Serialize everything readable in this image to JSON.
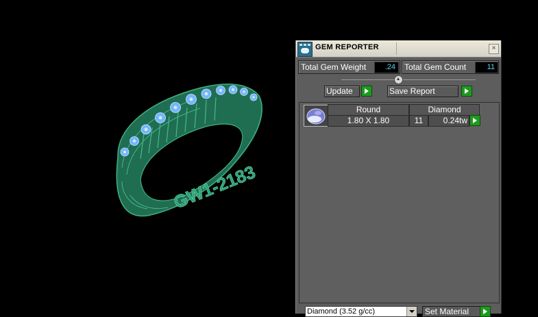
{
  "viewport": {
    "engraving": "GW1-2183"
  },
  "panel": {
    "title": "GEM REPORTER",
    "close_glyph": "×",
    "total_weight_label": "Total Gem Weight",
    "total_weight_value": ".24",
    "total_count_label": "Total Gem Count",
    "total_count_value": "11",
    "update_label": "Update",
    "save_report_label": "Save Report",
    "gem_row": {
      "shape": "Round",
      "material": "Diamond",
      "size": "1.80 X 1.80",
      "count": "11",
      "weight": "0.24tw"
    },
    "material_select": "Diamond    (3.52 g/cc)",
    "set_material_label": "Set Material"
  },
  "colors": {
    "ring_green": "#2a8c68",
    "gem_blue": "#74b6ff",
    "accent_cyan": "#58d4f0",
    "go_green": "#1f9a1f"
  }
}
